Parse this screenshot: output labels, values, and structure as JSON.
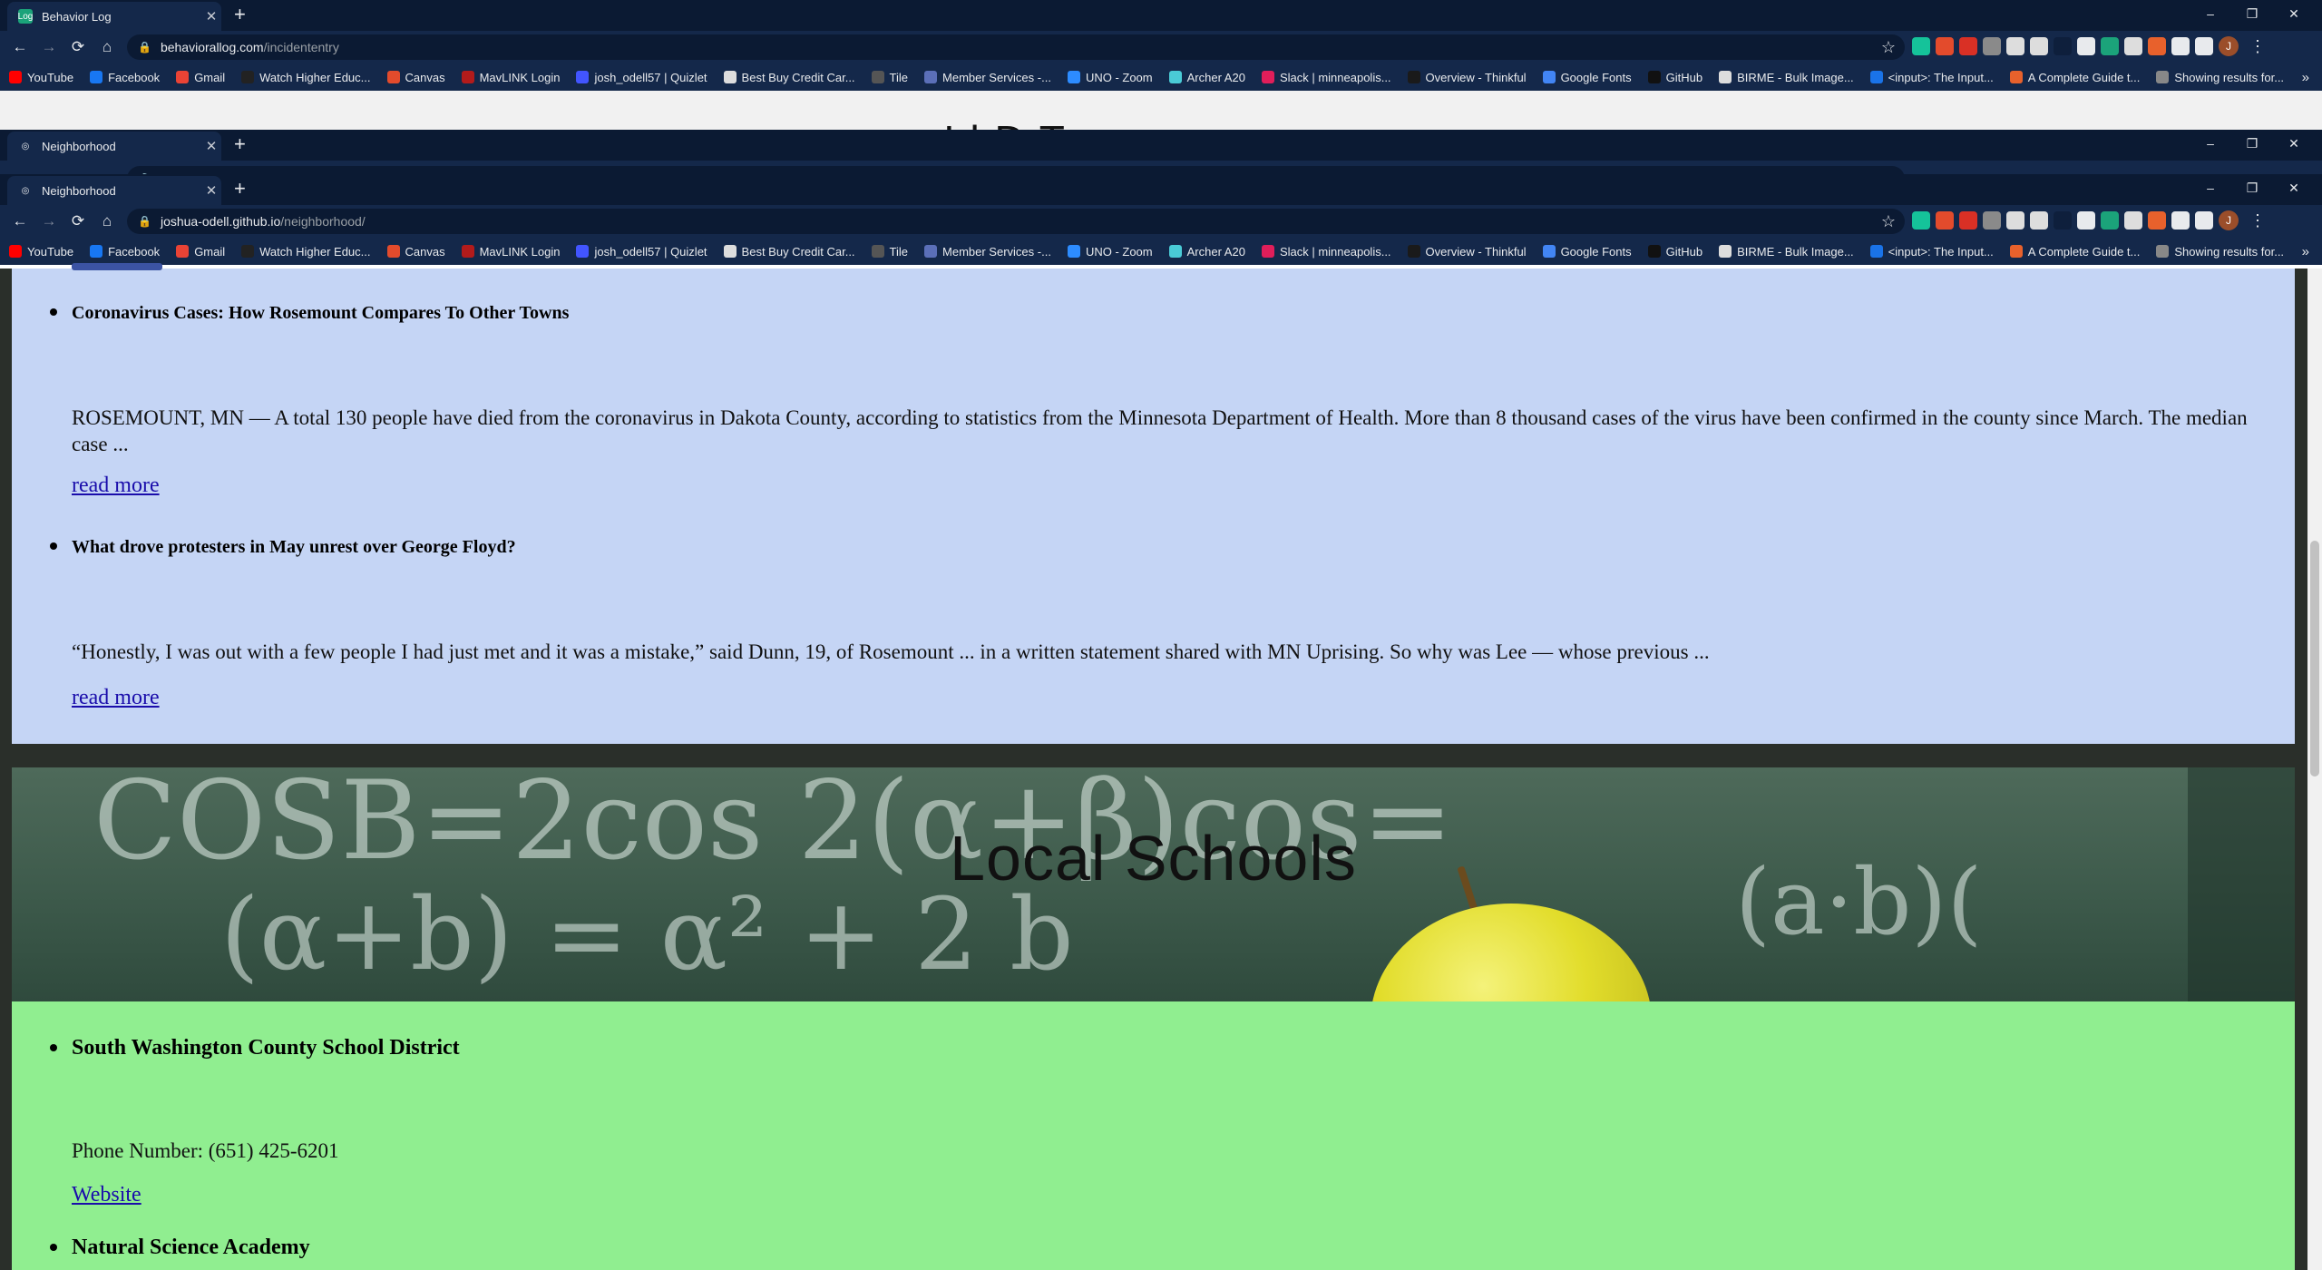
{
  "window1": {
    "tab_title": "Behavior Log",
    "tab_favicon": "Log",
    "url_host": "behaviorallog.com",
    "url_path": "/incidententry",
    "page_title_partial": "I  l  D    T"
  },
  "window2": {
    "tab_title": "Neighborhood",
    "url_host": "joshua-odell.github.io",
    "url_path": "/neighborhood/"
  },
  "window3": {
    "tab_title": "Neighborhood",
    "url_host": "joshua-odell.github.io",
    "url_path": "/neighborhood/"
  },
  "controls": {
    "new_tab": "+",
    "minimize": "–",
    "restore": "❐",
    "close": "✕",
    "profile_initial": "J"
  },
  "bookmarks": [
    {
      "label": "YouTube",
      "color": "#ff0000"
    },
    {
      "label": "Facebook",
      "color": "#1877f2"
    },
    {
      "label": "Gmail",
      "color": "#ea4335"
    },
    {
      "label": "Watch Higher Educ...",
      "color": "#222222"
    },
    {
      "label": "Canvas",
      "color": "#e34b2c"
    },
    {
      "label": "MavLINK Login",
      "color": "#b31b1b"
    },
    {
      "label": "josh_odell57 | Quizlet",
      "color": "#4255ff"
    },
    {
      "label": "Best Buy Credit Car...",
      "color": "#dddddd"
    },
    {
      "label": "Tile",
      "color": "#555555"
    },
    {
      "label": "Member Services -...",
      "color": "#5b6fb8"
    },
    {
      "label": "UNO - Zoom",
      "color": "#2d8cff"
    },
    {
      "label": "Archer A20",
      "color": "#4acbd6"
    },
    {
      "label": "Slack | minneapolis...",
      "color": "#e01e5a"
    },
    {
      "label": "Overview - Thinkful",
      "color": "#1a1a1a"
    },
    {
      "label": "Google Fonts",
      "color": "#4285f4"
    },
    {
      "label": "GitHub",
      "color": "#111111"
    },
    {
      "label": "BIRME - Bulk Image...",
      "color": "#dddddd"
    },
    {
      "label": "<input>: The Input...",
      "color": "#1a73e8"
    },
    {
      "label": "A Complete Guide t...",
      "color": "#e8612c"
    },
    {
      "label": "Showing results for...",
      "color": "#888888"
    }
  ],
  "extensions_colors": [
    "#15c39a",
    "#e34b2c",
    "#d93025",
    "#8a8a8a",
    "#dddddd",
    "#dddddd",
    "#0e1f3c",
    "#e8eaed",
    "#1ba37a",
    "#dddddd",
    "#e8612c",
    "#e8eaed",
    "#e8eaed"
  ],
  "news": {
    "items": [
      {
        "title": "Coronavirus Cases: How Rosemount Compares To Other Towns",
        "summary": "ROSEMOUNT, MN — A total 130 people have died from the coronavirus in Dakota County, according to statistics from the Minnesota Department of Health. More than 8 thousand cases of the virus have been confirmed in the county since March. The median case ...",
        "link": "read more"
      },
      {
        "title": "What drove protesters in May unrest over George Floyd?",
        "summary": "“Honestly, I was out with a few people I had just met and it was a mistake,” said Dunn, 19, of Rosemount ... in a written statement shared with MN Uprising. So why was Lee — whose previous ...",
        "link": "read more"
      }
    ]
  },
  "schools": {
    "banner_title": "Local Schools",
    "items": [
      {
        "name": "South Washington County School District",
        "phone": "Phone Number: (651) 425-6201",
        "link": "Website"
      },
      {
        "name": "Natural Science Academy"
      }
    ]
  },
  "colors": {
    "news_bg": "#c5d5f5",
    "schools_bg": "#90ee90",
    "chrome_dark": "#0b1a33",
    "link": "#1a0dab"
  }
}
